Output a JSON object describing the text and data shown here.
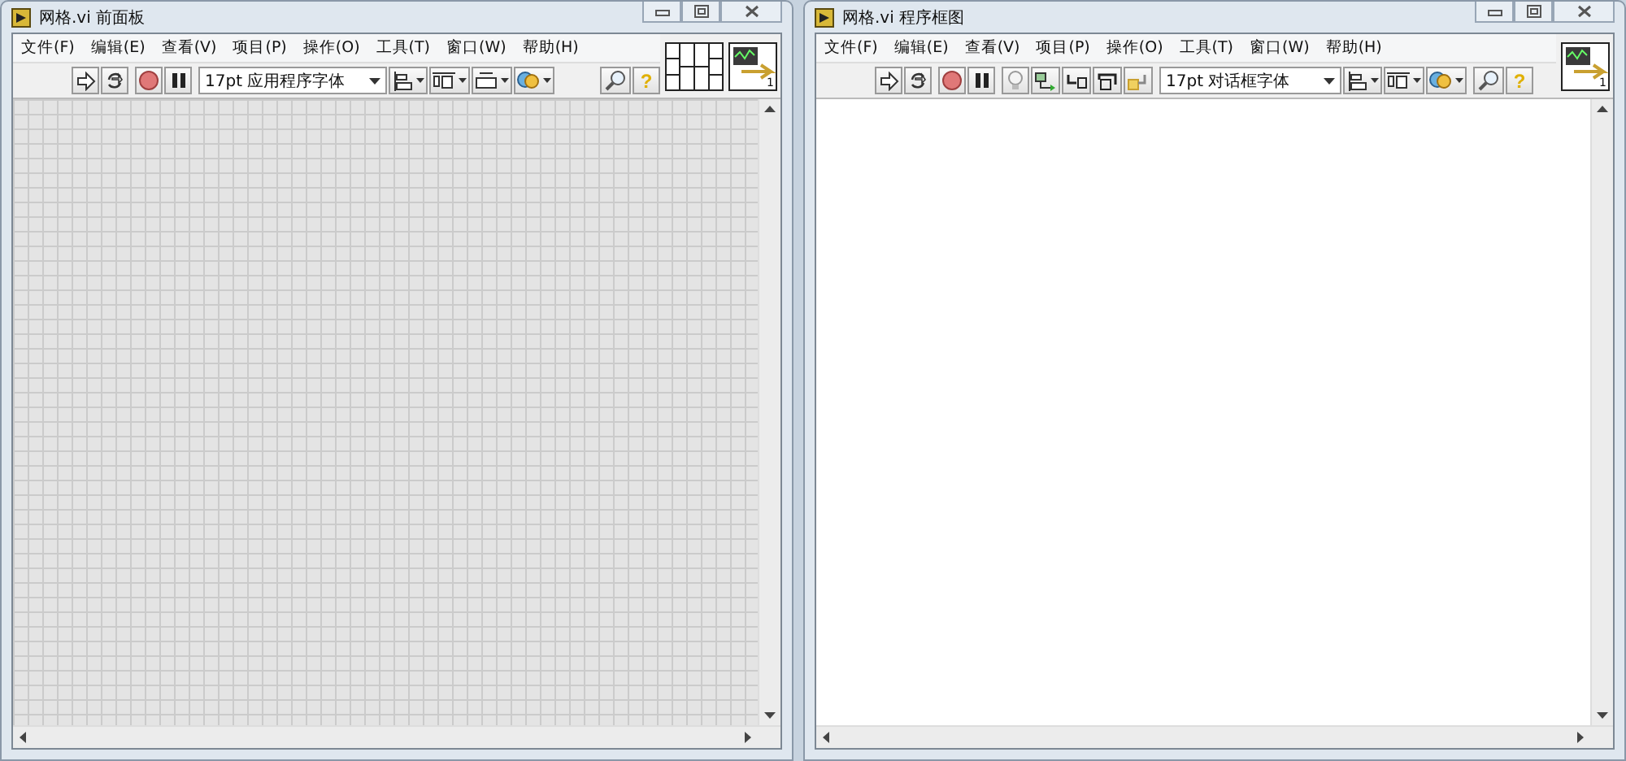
{
  "windows": [
    {
      "kind": "front-panel",
      "title": "网格.vi 前面板",
      "menu": [
        "文件(F)",
        "编辑(E)",
        "查看(V)",
        "项目(P)",
        "操作(O)",
        "工具(T)",
        "窗口(W)",
        "帮助(H)"
      ],
      "toolbar": [
        {
          "kind": "run"
        },
        {
          "kind": "run-continuous"
        },
        {
          "kind": "abort"
        },
        {
          "kind": "pause"
        },
        {
          "kind": "font",
          "text": "17pt 应用程序字体"
        },
        {
          "kind": "align"
        },
        {
          "kind": "distribute"
        },
        {
          "kind": "resize"
        },
        {
          "kind": "reorder"
        },
        {
          "kind": "spacer"
        },
        {
          "kind": "search"
        },
        {
          "kind": "help",
          "glyph": "?"
        }
      ],
      "vi_icon_label": "1"
    },
    {
      "kind": "block-diagram",
      "title": "网格.vi 程序框图",
      "menu": [
        "文件(F)",
        "编辑(E)",
        "查看(V)",
        "项目(P)",
        "操作(O)",
        "工具(T)",
        "窗口(W)",
        "帮助(H)"
      ],
      "toolbar": [
        {
          "kind": "run"
        },
        {
          "kind": "run-continuous"
        },
        {
          "kind": "abort"
        },
        {
          "kind": "pause"
        },
        {
          "kind": "highlight"
        },
        {
          "kind": "retain"
        },
        {
          "kind": "step-into"
        },
        {
          "kind": "step-over"
        },
        {
          "kind": "step-out"
        },
        {
          "kind": "font",
          "text": "17pt 对话框字体"
        },
        {
          "kind": "align"
        },
        {
          "kind": "distribute"
        },
        {
          "kind": "reorder"
        },
        {
          "kind": "search"
        },
        {
          "kind": "help",
          "glyph": "?"
        }
      ],
      "vi_icon_label": "1"
    }
  ]
}
